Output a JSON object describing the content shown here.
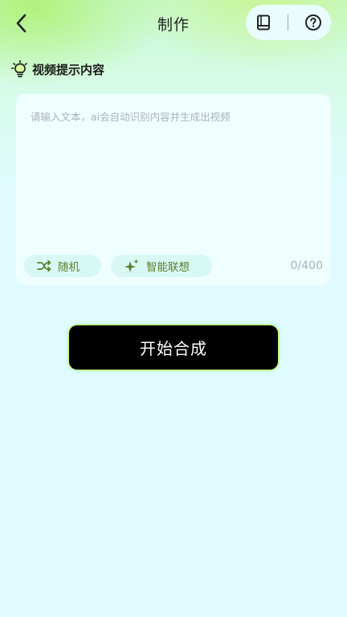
{
  "header": {
    "title": "制作",
    "back_icon": "chevron-left-icon",
    "guide_icon": "book-icon",
    "help_icon": "question-circle-icon"
  },
  "section": {
    "title": "视频提示内容",
    "icon": "lightbulb-icon"
  },
  "prompt": {
    "value": "",
    "placeholder": "请输入文本，ai会自动识别内容并生成出视频",
    "counter": "0/400"
  },
  "chips": {
    "random_label": "随机",
    "random_icon": "shuffle-icon",
    "smart_label": "智能联想",
    "smart_icon": "sparkle-icon"
  },
  "primary": {
    "label": "开始合成"
  },
  "colors": {
    "accent_green": "#b9f37a",
    "chip_text": "#5c7e2a",
    "button_bg": "#000000",
    "page_bg": "#e0fbff"
  }
}
